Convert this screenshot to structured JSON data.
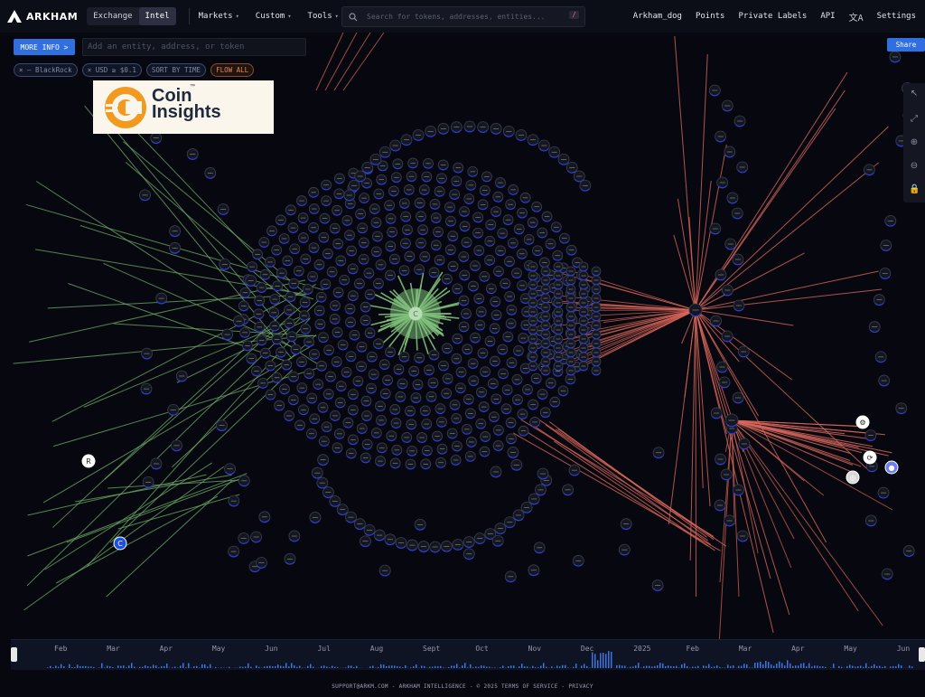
{
  "nav": {
    "brand": "ARKHAM",
    "modes": [
      "Exchange",
      "Intel"
    ],
    "active_mode": "Intel",
    "menus": [
      "Markets",
      "Custom",
      "Tools"
    ],
    "search_placeholder": "Search for tokens, addresses, entities...",
    "search_shortcut": "/",
    "right_items": [
      "Arkham_dog",
      "Points",
      "Private Labels",
      "API",
      "Settings"
    ],
    "translate_icon": "translate-icon"
  },
  "controls": {
    "more_info": "MORE INFO >",
    "entity_placeholder": "Add an entity, address, or token",
    "filters": [
      {
        "label": "× — BlackRock",
        "kind": "entity"
      },
      {
        "label": "× USD ≥ $0.1",
        "kind": "value"
      },
      {
        "label": "SORT BY TIME",
        "kind": "sort"
      },
      {
        "label": "FLOW ALL",
        "kind": "flow"
      }
    ],
    "share": "Share"
  },
  "watermark": {
    "line1": "Coin",
    "line2": "Insights",
    "tm": "™"
  },
  "graph": {
    "colors": {
      "inflow": "#6fae6a",
      "outflow": "#d9665a",
      "node": "#15171f",
      "node_ring": "#2e3ce0",
      "center": "#7ec07a"
    },
    "center_entity_icon": "coinbase-icon"
  },
  "timeline": {
    "months": [
      "Feb",
      "Mar",
      "Apr",
      "May",
      "Jun",
      "Jul",
      "Aug",
      "Sept",
      "Oct",
      "Nov",
      "Dec",
      "2025",
      "Feb",
      "Mar",
      "Apr",
      "May",
      "Jun"
    ],
    "bar_color": "#3b74e0"
  },
  "footer": "SUPPORT@ARKM.COM - ARKHAM INTELLIGENCE - © 2025  TERMS OF SERVICE - PRIVACY"
}
